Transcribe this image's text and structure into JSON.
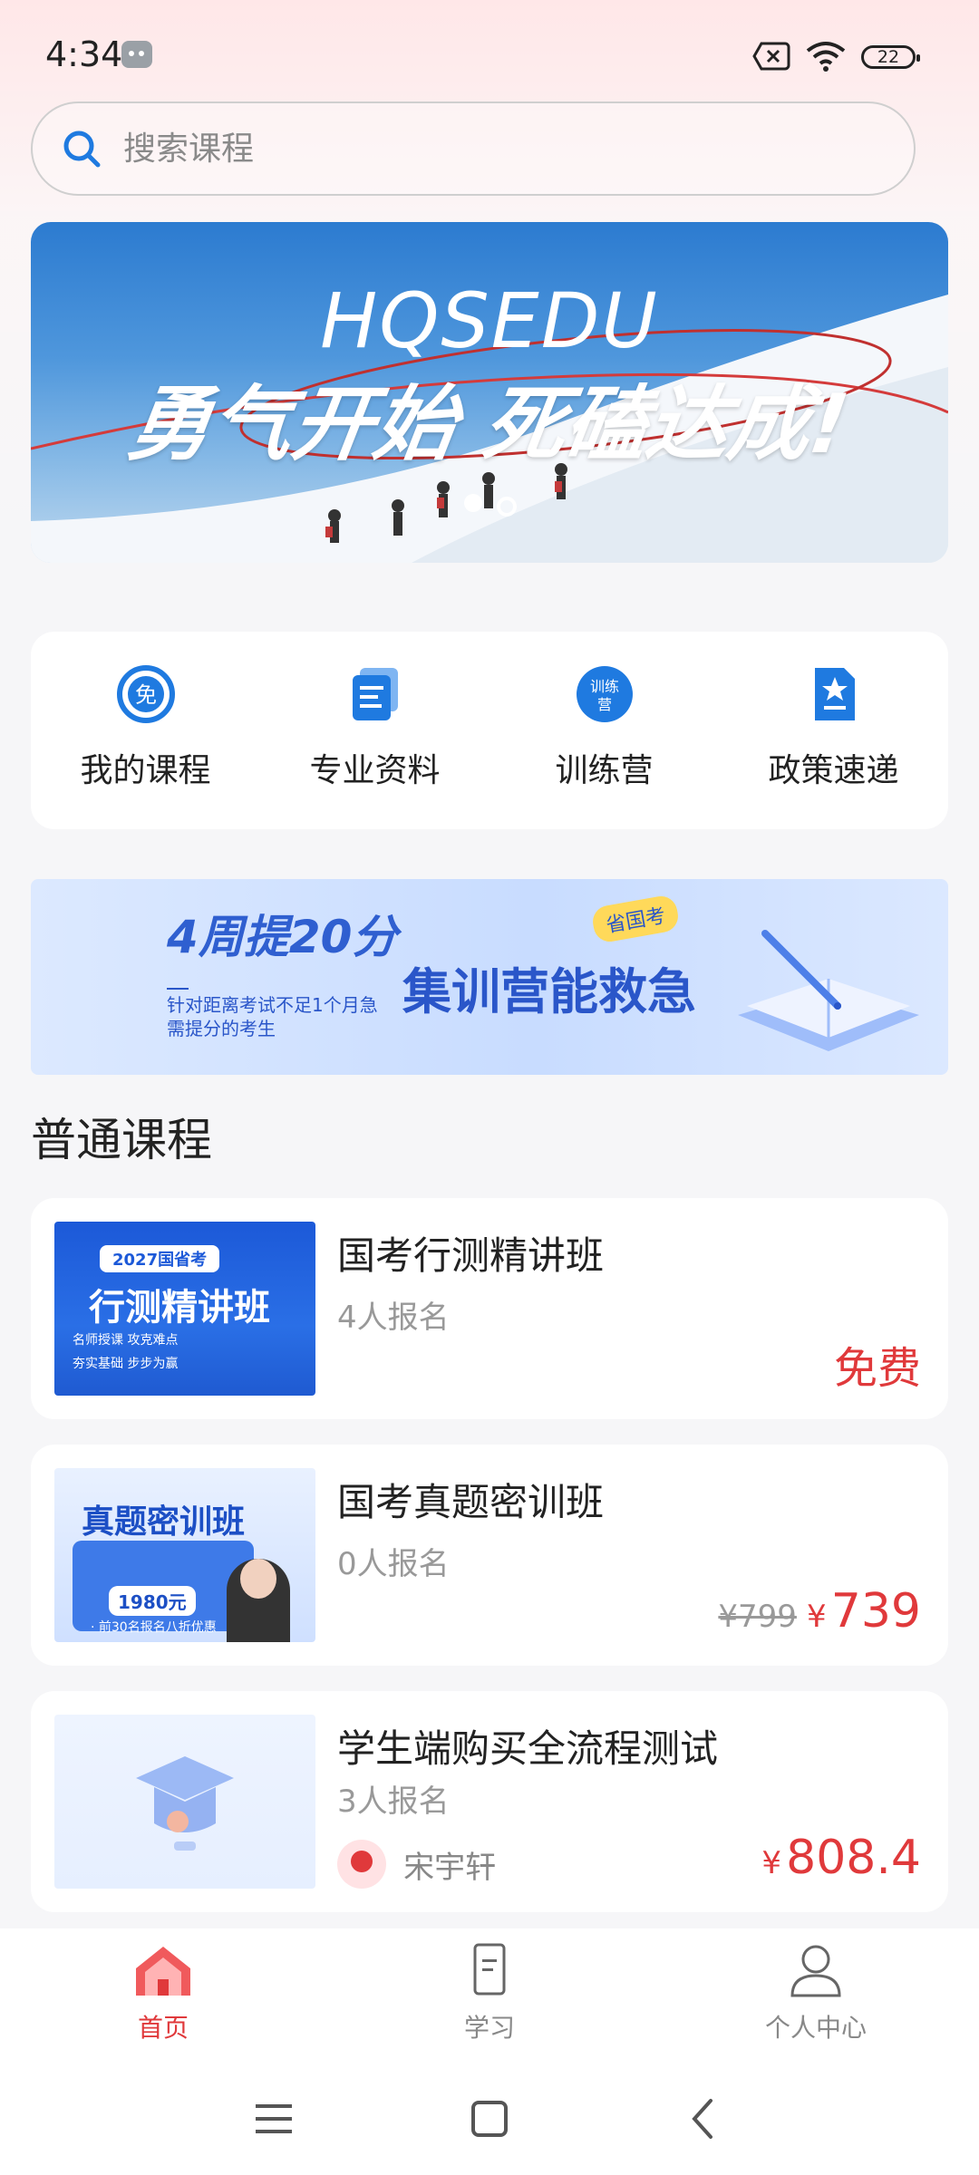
{
  "status_bar": {
    "time": "4:34",
    "battery": "22"
  },
  "search": {
    "placeholder": "搜索课程"
  },
  "banner": {
    "brand": "HQSEDU",
    "slogan": "勇气开始 死磕达成!"
  },
  "quick_links": [
    {
      "label": "我的课程",
      "icon": "free-badge-icon"
    },
    {
      "label": "专业资料",
      "icon": "documents-icon"
    },
    {
      "label": "训练营",
      "icon": "training-camp-icon"
    },
    {
      "label": "政策速递",
      "icon": "policy-star-document-icon"
    }
  ],
  "promo": {
    "headline": "4周提20分",
    "main": "集训营能救急",
    "tag": "省国考",
    "desc": "针对距离考试不足1个月急需提分的考生"
  },
  "section": {
    "title": "普通课程"
  },
  "courses": [
    {
      "title": "国考行测精讲班",
      "count": "4人报名",
      "price_label": "免费",
      "thumb": {
        "tag": "2027国省考",
        "main": "行测精讲班",
        "line1": "名师授课 攻克难点",
        "line2": "夯实基础 步步为赢"
      }
    },
    {
      "title": "国考真题密训班",
      "count": "0人报名",
      "old_price": "¥799",
      "currency": "¥",
      "price": "739",
      "thumb": {
        "main": "真题密训班",
        "price": "1980元",
        "sub": "· 前30名报名八折优惠"
      }
    },
    {
      "title": "学生端购买全流程测试",
      "count": "3人报名",
      "teacher": "宋宇轩",
      "currency": "¥",
      "price": "808.4"
    }
  ],
  "tabbar": [
    {
      "label": "首页",
      "active": true
    },
    {
      "label": "学习",
      "active": false
    },
    {
      "label": "个人中心",
      "active": false
    }
  ],
  "colors": {
    "accent_red": "#e0393b",
    "brand_blue": "#1f7ae0"
  }
}
